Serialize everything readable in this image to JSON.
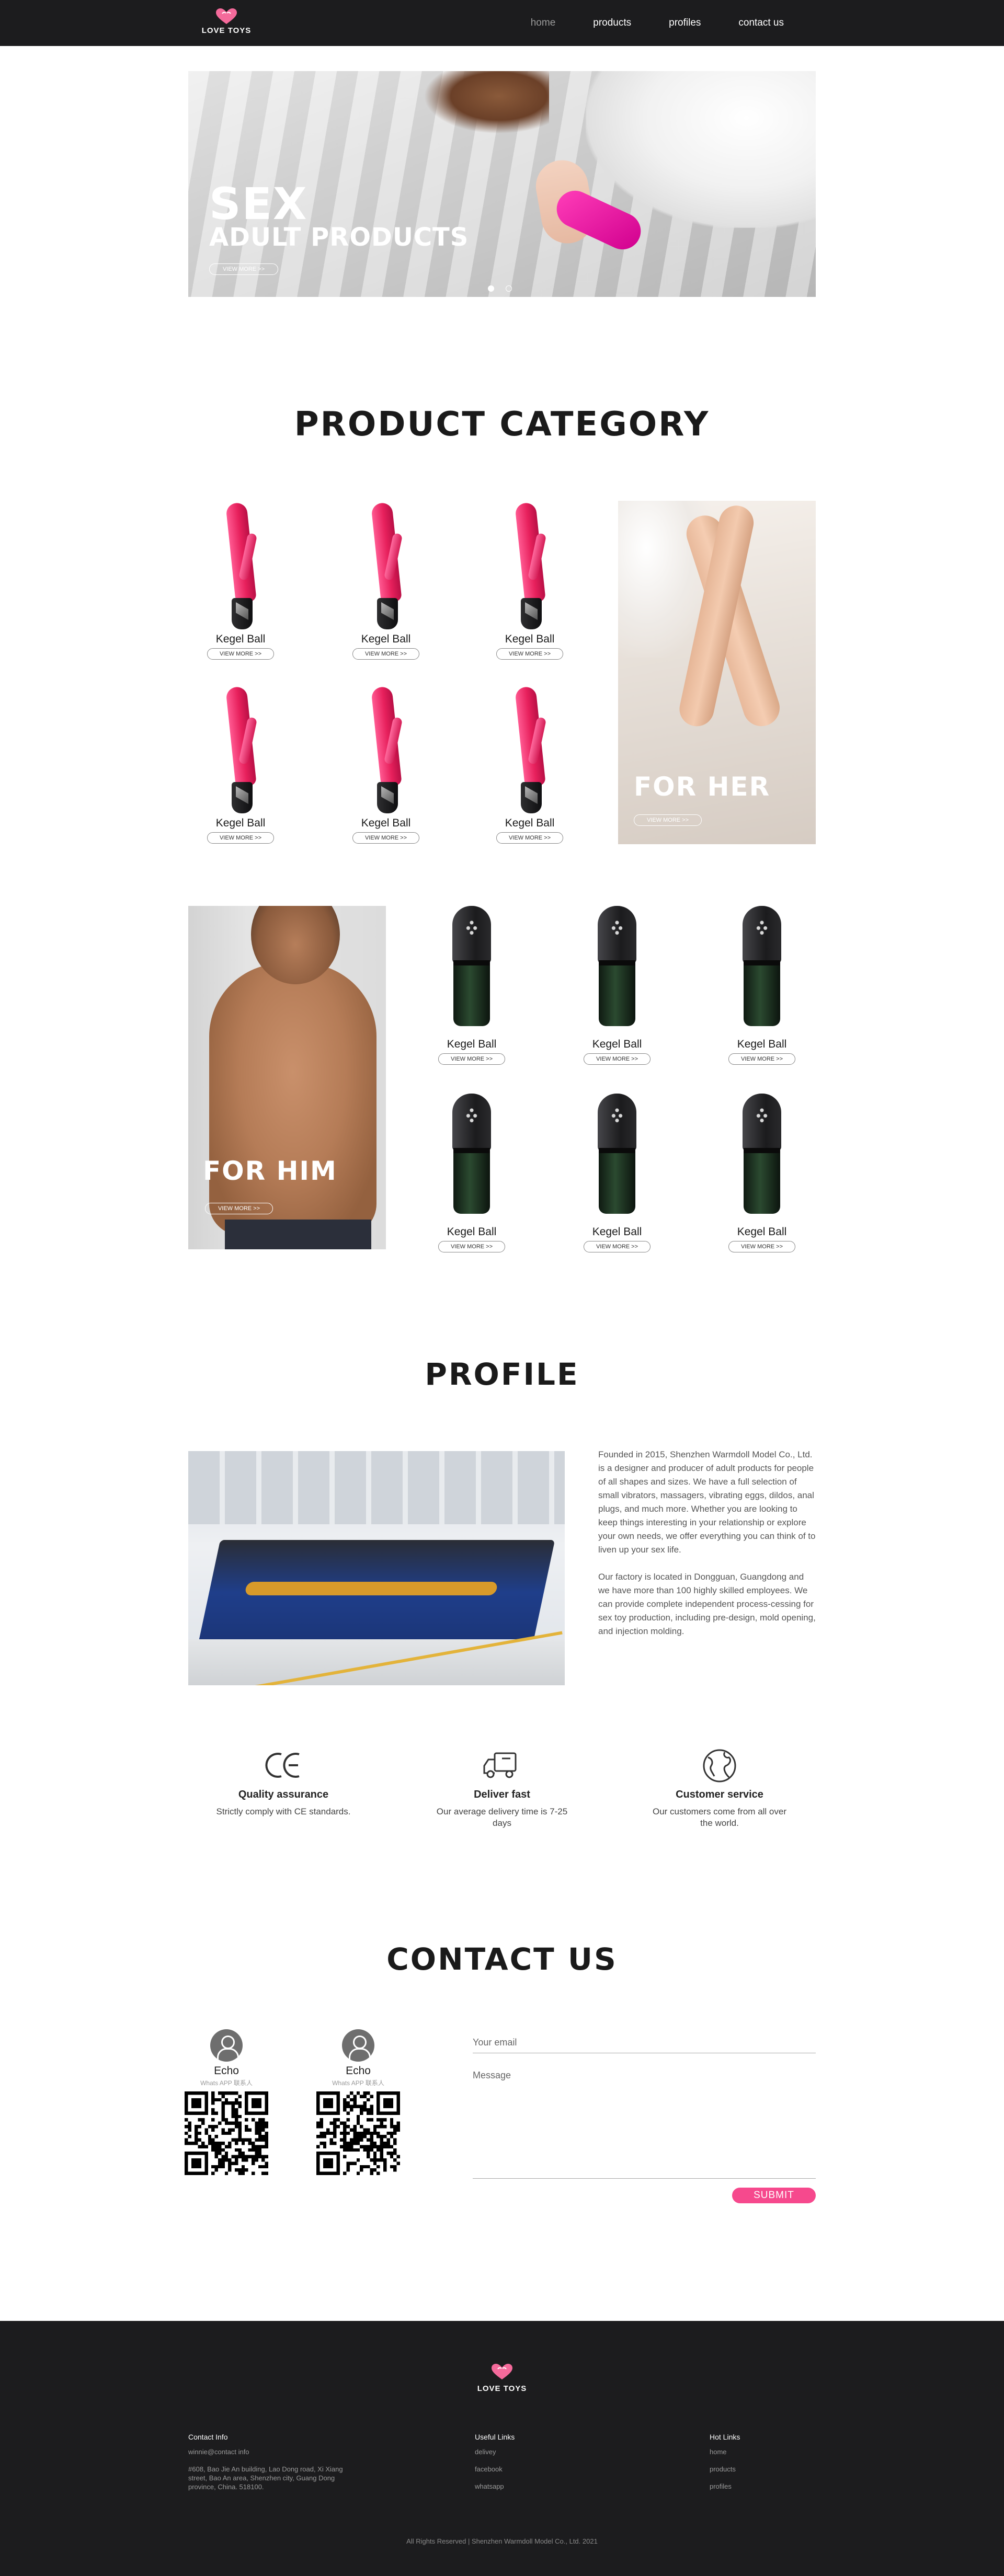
{
  "header": {
    "logo_text": "LOVE TOYS",
    "nav": [
      {
        "label": "home",
        "active": true
      },
      {
        "label": "products"
      },
      {
        "label": "profiles"
      },
      {
        "label": "contact us"
      }
    ]
  },
  "hero": {
    "title": "SEX",
    "subtitle": "ADULT PRODUCTS",
    "button": "VIEW MORE >>",
    "slides": 2,
    "active_slide": 1
  },
  "product_category": {
    "title": "PRODUCT CATEGORY",
    "for_her": {
      "title": "FOR HER",
      "button": "VIEW MORE >>"
    },
    "for_him": {
      "title": "FOR HIM",
      "button": "VIEW MORE >>"
    },
    "her_products": [
      {
        "name": "Kegel Ball",
        "button": "VIEW MORE >>"
      },
      {
        "name": "Kegel Ball",
        "button": "VIEW MORE >>"
      },
      {
        "name": "Kegel Ball",
        "button": "VIEW MORE >>"
      },
      {
        "name": "Kegel Ball",
        "button": "VIEW MORE >>"
      },
      {
        "name": "Kegel Ball",
        "button": "VIEW MORE >>"
      },
      {
        "name": "Kegel Ball",
        "button": "VIEW MORE >>"
      }
    ],
    "him_products": [
      {
        "name": "Kegel Ball",
        "button": "VIEW MORE >>"
      },
      {
        "name": "Kegel Ball",
        "button": "VIEW MORE >>"
      },
      {
        "name": "Kegel Ball",
        "button": "VIEW MORE >>"
      },
      {
        "name": "Kegel Ball",
        "button": "VIEW MORE >>"
      },
      {
        "name": "Kegel Ball",
        "button": "VIEW MORE >>"
      },
      {
        "name": "Kegel Ball",
        "button": "VIEW MORE >>"
      }
    ]
  },
  "profile": {
    "title": "PROFILE",
    "para1": "Founded in 2015, Shenzhen Warmdoll Model Co., Ltd. is a designer and producer of adult products for people of all shapes and sizes. We have a full selection of small vibrators, massagers, vibrating eggs, dildos, anal plugs, and much more. Whether you are looking to keep things interesting in your relationship or explore your own needs, we offer everything you can think of to liven up your sex life.",
    "para2": "Our factory is located in Dongguan, Guangdong and we have more than 100 highly skilled employees. We can provide complete independent process-cessing for sex toy production, including pre-design, mold opening, and injection molding."
  },
  "features": [
    {
      "icon": "ce-mark-icon",
      "title": "Quality assurance",
      "desc": "Strictly comply with CE standards."
    },
    {
      "icon": "delivery-truck-icon",
      "title": "Deliver fast",
      "desc": "Our average delivery time is 7-25 days"
    },
    {
      "icon": "globe-icon",
      "title": "Customer service",
      "desc": "Our customers come from all over the world."
    }
  ],
  "contact": {
    "title": "CONTACT US",
    "cards": [
      {
        "name": "Echo",
        "sub": "Whats APP 联系人"
      },
      {
        "name": "Echo",
        "sub": "Whats APP 联系人"
      }
    ],
    "email_placeholder": "Your email",
    "message_placeholder": "Message",
    "submit": "SUBMIT"
  },
  "footer": {
    "logo_text": "LOVE TOYS",
    "contact_info": {
      "heading": "Contact Info",
      "email": "winnie@contact info",
      "address": "#608, Bao Jie An building, Lao Dong road, Xi Xiang street, Bao An area, Shenzhen city, Guang Dong province, China. 518100."
    },
    "useful_links": {
      "heading": "Useful Links",
      "items": [
        "delivey",
        "facebook",
        "whatsapp"
      ]
    },
    "hot_links": {
      "heading": "Hot Links",
      "items": [
        "home",
        "products",
        "profiles"
      ]
    },
    "copyright": "All Rights Reserved | Shenzhen Warmdoll Model Co., Ltd.   2021"
  },
  "colors": {
    "header_bg": "#1c1c1e",
    "accent_pink": "#f6498d",
    "vibrator_pink": "#e7205c",
    "text_dark": "#1a1a1a"
  }
}
